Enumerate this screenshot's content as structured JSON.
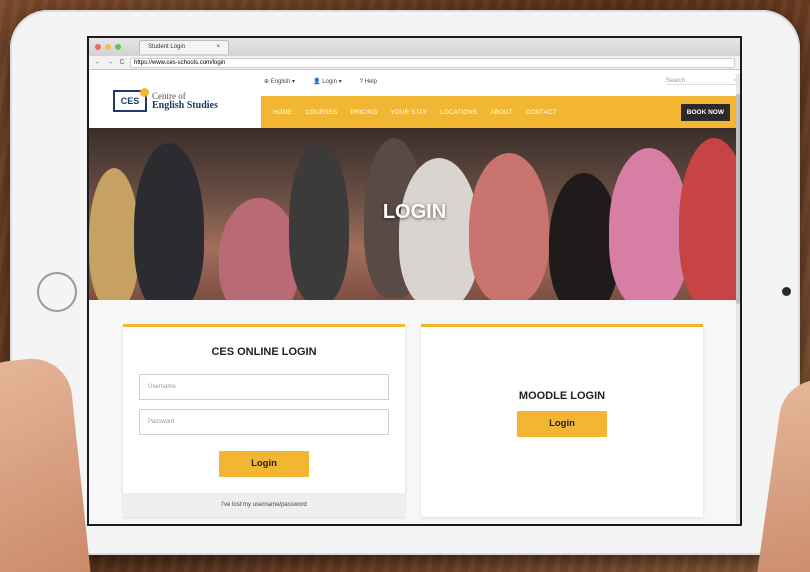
{
  "browser": {
    "tab_title": "Student Login",
    "tab_close": "×",
    "url_secure": "https",
    "url": "https://www.ces-schools.com/login",
    "nav": {
      "back": "←",
      "forward": "→",
      "reload": "C"
    }
  },
  "utility_bar": {
    "language": "English",
    "login": "Login",
    "help": "Help",
    "search_placeholder": "Search",
    "search_arrow": "›"
  },
  "logo": {
    "mark": "CES",
    "line1": "Centre of",
    "line2": "English Studies"
  },
  "nav": {
    "items": [
      "HOME",
      "COURSES",
      "PRICING",
      "YOUR STAY",
      "LOCATIONS",
      "ABOUT",
      "CONTACT"
    ],
    "book_now": "BOOK NOW"
  },
  "hero": {
    "title": "LOGIN"
  },
  "ces_login": {
    "heading": "CES ONLINE LOGIN",
    "username_placeholder": "Username",
    "password_placeholder": "Password",
    "button": "Login",
    "forgot": "I've lost my username/password"
  },
  "moodle_login": {
    "heading": "MOODLE LOGIN",
    "button": "Login"
  },
  "colors": {
    "accent": "#f2b632",
    "brand_navy": "#1f3a6d",
    "book_button": "#2a2a2a"
  }
}
